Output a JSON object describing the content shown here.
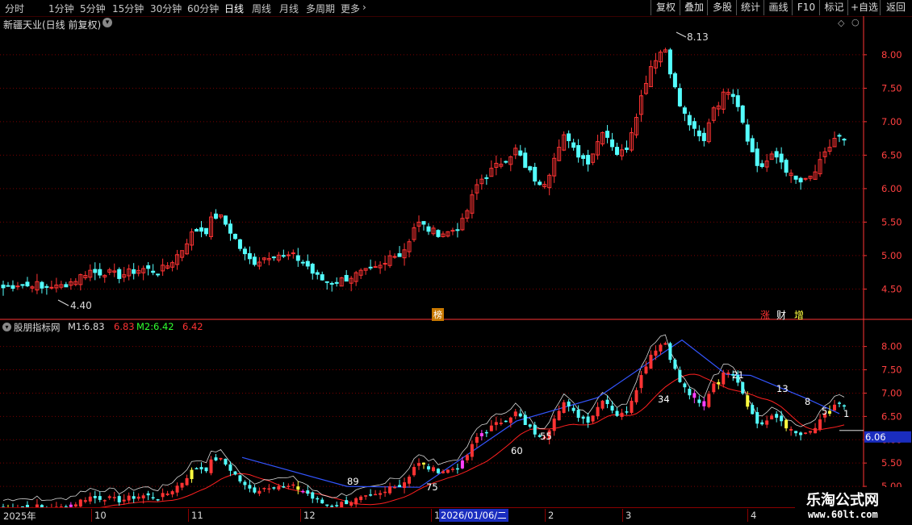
{
  "toolbar": {
    "periods": [
      "分时",
      "1分钟",
      "5分钟",
      "15分钟",
      "30分钟",
      "60分钟",
      "日线",
      "周线",
      "月线",
      "多周期",
      "更多"
    ],
    "active_period": "日线",
    "buttons": [
      "复权",
      "叠加",
      "多股",
      "统计",
      "画线",
      "F10",
      "标记",
      "+自选",
      "返回"
    ]
  },
  "main_title": "新疆天业(日线 前复权)",
  "indicator": {
    "name": "股朋指标网",
    "m1_label": "M1:",
    "m1_value": "6.83",
    "m1_value2": "6.83",
    "m2_label": "M2:",
    "m2_value": "6.42",
    "m2_value2": "6.42"
  },
  "date_axis": [
    "2025年",
    "10",
    "11",
    "12",
    "1",
    "2026/01/06/二",
    "2",
    "3",
    "4"
  ],
  "watermark": {
    "line1": "乐淘公式网",
    "line2": "www.60lt.com"
  },
  "badges": {
    "bang": "榜",
    "zhang": "涨",
    "cai": "财",
    "zeng": "增"
  },
  "colors": {
    "up": "#ff3333",
    "down": "#54ffff",
    "grid": "#7a0000",
    "axis": "#ff3333",
    "ma": "#ff2020",
    "trend": "#3355ff",
    "white": "#ffffff",
    "yellow": "#ffff40",
    "magenta": "#ff40ff"
  },
  "chart_data": [
    {
      "type": "candlestick",
      "title": "新疆天业(日线 前复权)",
      "y_ticks": [
        4.5,
        5.0,
        5.5,
        6.0,
        6.5,
        7.0,
        7.5,
        8.0
      ],
      "ylim": [
        4.24,
        8.36
      ],
      "annotations": [
        {
          "label": "8.13",
          "note": "high"
        },
        {
          "label": "4.40",
          "note": "low"
        }
      ],
      "close_path": [
        4.52,
        4.55,
        4.58,
        4.54,
        4.6,
        4.5,
        4.56,
        4.52,
        4.58,
        4.62,
        4.7,
        4.78,
        4.74,
        4.76,
        4.72,
        4.7,
        4.74,
        4.78,
        4.8,
        4.78,
        4.76,
        4.84,
        4.96,
        5.1,
        5.3,
        5.4,
        5.36,
        5.6,
        5.56,
        5.4,
        5.2,
        5.0,
        4.9,
        4.94,
        5.0,
        5.04,
        4.98,
        5.0,
        4.94,
        4.86,
        4.7,
        4.64,
        4.6,
        4.62,
        4.66,
        4.7,
        4.74,
        4.76,
        4.8,
        4.86,
        5.06,
        5.0,
        5.2,
        5.5,
        5.44,
        5.36,
        5.34,
        5.34,
        5.4,
        5.5,
        5.8,
        6.1,
        6.2,
        6.3,
        6.4,
        6.5,
        6.6,
        6.3,
        6.2,
        6.0,
        6.2,
        6.6,
        6.8,
        6.6,
        6.5,
        6.4,
        6.6,
        6.9,
        6.7,
        6.5,
        6.6,
        7.0,
        7.4,
        7.8,
        8.0,
        8.1,
        7.6,
        7.2,
        7.0,
        6.8,
        6.7,
        7.2,
        7.3,
        7.5,
        7.4,
        7.0,
        6.6,
        6.3,
        6.4,
        6.5,
        6.4,
        6.2,
        6.1,
        6.1,
        6.2,
        6.4,
        6.6,
        6.8,
        6.7
      ],
      "ma_series": [
        {
          "name": "M1",
          "last": 6.83
        },
        {
          "name": "M2",
          "last": 6.42
        }
      ],
      "indicator_labels": [
        "89",
        "75",
        "60",
        "55",
        "34",
        "21",
        "13",
        "8",
        "5",
        "1"
      ],
      "price_tag": "6.06"
    }
  ]
}
